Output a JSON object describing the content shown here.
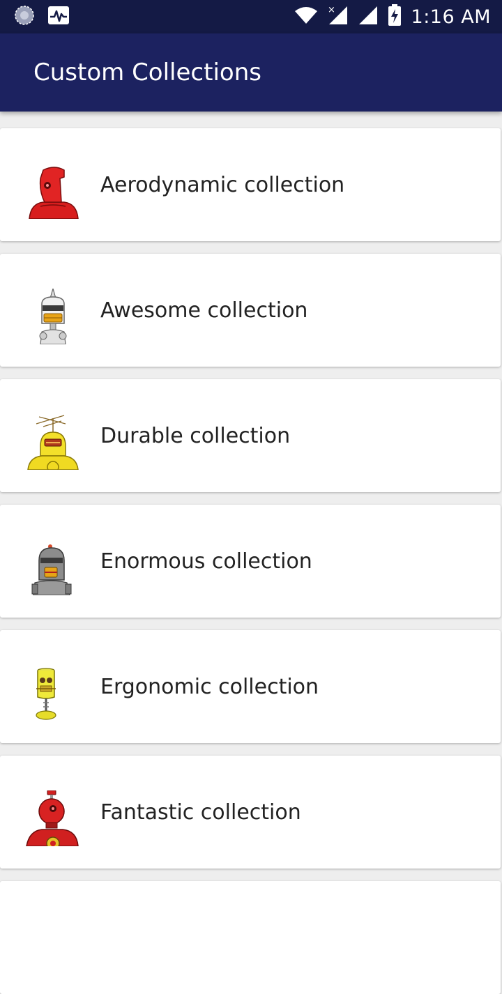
{
  "status_bar": {
    "time": "1:16 AM",
    "icons": [
      "sync-icon",
      "activity-icon",
      "wifi-icon",
      "no-data-signal-icon",
      "signal-icon",
      "battery-charging-icon"
    ]
  },
  "app_bar": {
    "title": "Custom Collections",
    "color": "#1c2260"
  },
  "collections": [
    {
      "label": "Aerodynamic collection",
      "icon": "red-robot-icon"
    },
    {
      "label": "Awesome collection",
      "icon": "white-robot-icon"
    },
    {
      "label": "Durable collection",
      "icon": "yellow-robot-icon"
    },
    {
      "label": "Enormous collection",
      "icon": "gray-robot-icon"
    },
    {
      "label": "Ergonomic collection",
      "icon": "yellow-box-robot-icon"
    },
    {
      "label": "Fantastic collection",
      "icon": "red-round-robot-icon"
    }
  ]
}
